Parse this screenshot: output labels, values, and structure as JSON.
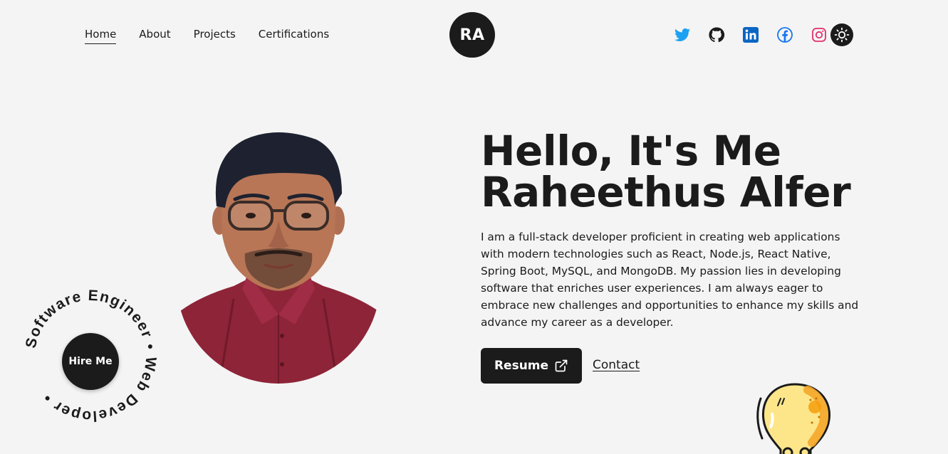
{
  "nav": {
    "items": [
      {
        "label": "Home",
        "active": true
      },
      {
        "label": "About",
        "active": false
      },
      {
        "label": "Projects",
        "active": false
      },
      {
        "label": "Certifications",
        "active": false
      }
    ]
  },
  "logo": {
    "initials": "RA"
  },
  "socials": [
    {
      "name": "twitter-icon",
      "color": "#1da1f2"
    },
    {
      "name": "github-icon",
      "color": "#1b1b1b"
    },
    {
      "name": "linkedin-icon",
      "color": "#0a66c2"
    },
    {
      "name": "facebook-icon",
      "color": "#1877f2"
    },
    {
      "name": "instagram-icon",
      "color": "#e1306c"
    }
  ],
  "theme_toggle": {
    "icon": "sun-icon"
  },
  "hero": {
    "headline_line1": "Hello, It's Me",
    "headline_line2": "Raheethus Alfer",
    "bio": "I am a full-stack developer proficient in creating web applications with modern technologies such as React, Node.js, React Native, Spring Boot, MySQL, and MongoDB. My passion lies in developing software that enriches user experiences. I am always eager to embrace new challenges and opportunities to enhance my skills and advance my career as a developer.",
    "resume_label": "Resume",
    "contact_label": "Contact"
  },
  "badge": {
    "ring_text": "Software Engineer • Web Developer •",
    "button_label": "Hire Me"
  },
  "colors": {
    "background": "#f4f4f4",
    "dark": "#1b1b1b",
    "shirt": "#8e2438",
    "bulb": "#fde68a"
  }
}
